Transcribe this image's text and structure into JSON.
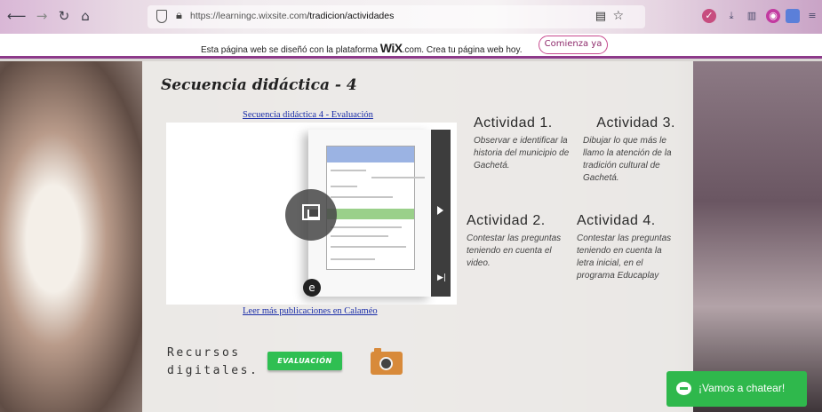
{
  "browser": {
    "url_host": "https://learningc.wixsite.com",
    "url_path": "/tradicion/actividades"
  },
  "wix_banner": {
    "message_before": "Esta página web se diseñó con la plataforma ",
    "brand": "WiX",
    "message_after": ".com. Crea tu página web hoy.",
    "cta_label": "Comienza ya"
  },
  "page": {
    "title": "Secuencia didáctica - 4",
    "doc_link": "Secuencia didáctica 4 - Evaluación",
    "more_link": "Leer más publicaciones en Calaméo"
  },
  "activities": [
    {
      "title": "Actividad 1.",
      "text": "Observar e identificar la historia del municipio de Gachetá."
    },
    {
      "title": "Actividad 3.",
      "text": "Dibujar lo que más le llamo la atención de la tradición cultural de Gachetá."
    },
    {
      "title": "Actividad 2.",
      "text": "Contestar las preguntas teniendo en cuenta el video."
    },
    {
      "title": "Actividad 4.",
      "text": "Contestar las preguntas teniendo en cuenta la letra inicial, en el programa Educaplay"
    }
  ],
  "resources": {
    "label_line1": "Recursos",
    "label_line2": "digitales.",
    "eval_button": "EVALUACIÓN"
  },
  "chat": {
    "label": "¡Vamos a chatear!"
  },
  "colors": {
    "wix_cta": "#c84b8f",
    "eval_button": "#2fbf52",
    "chat_button": "#2fb84c",
    "link": "#1a2da8"
  }
}
